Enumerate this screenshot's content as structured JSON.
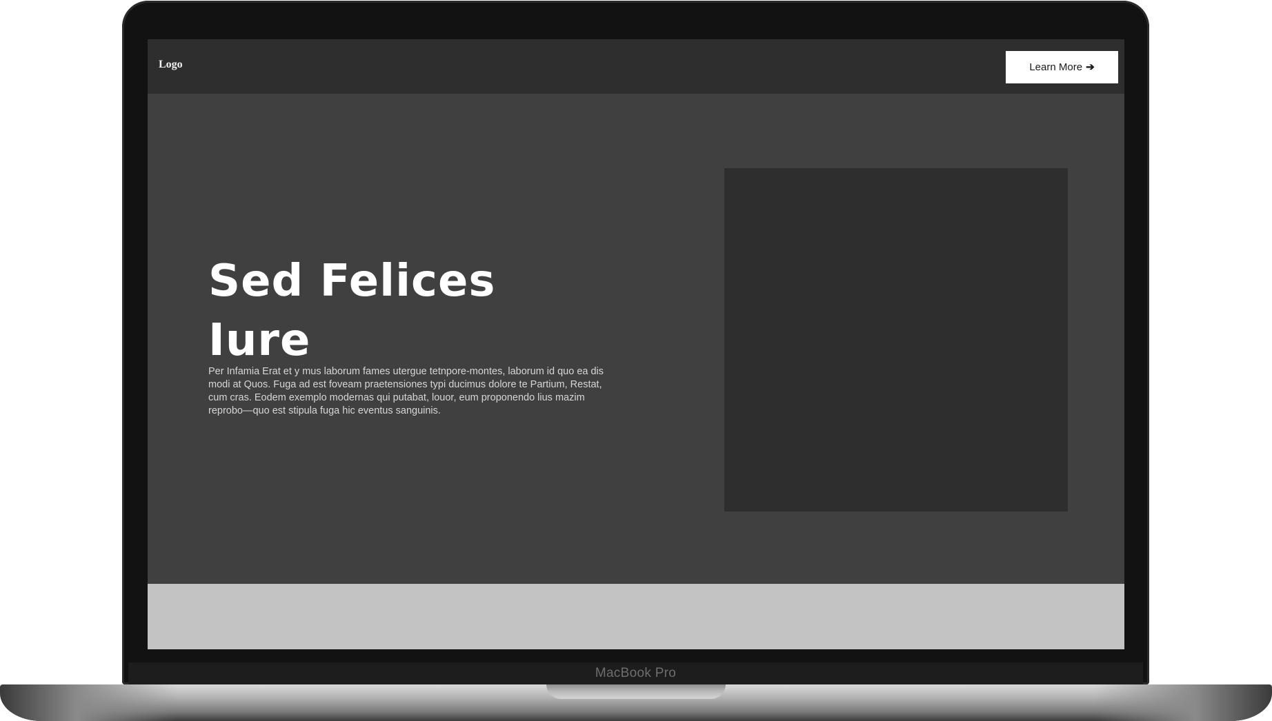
{
  "device": {
    "model_label": "MacBook Pro"
  },
  "nav": {
    "logo_text": "Logo",
    "cta_label": "Learn More",
    "cta_icon": "arrow-right-icon"
  },
  "hero": {
    "title_line1": "Sed Felices",
    "title_line2": "Iure",
    "body": "Per Infamia Erat et y mus laborum fames utergue tetnpore-montes, laborum id quo ea dis modi at Quos. Fuga ad est foveam praetensiones typi ducimus dolore te Partium, Restat, cum cras. Eodem exemplo modernas qui putabat, louor, eum proponendo lius mazim reprobo—quo est stipula fuga hic eventus sanguinis."
  },
  "colors": {
    "screen_bg": "#404040",
    "nav_bg": "#2e2e2e",
    "image_placeholder": "#2e2e2e",
    "footer_band": "#c3c3c3",
    "button_bg": "#ffffff",
    "bezel": "#121212"
  }
}
